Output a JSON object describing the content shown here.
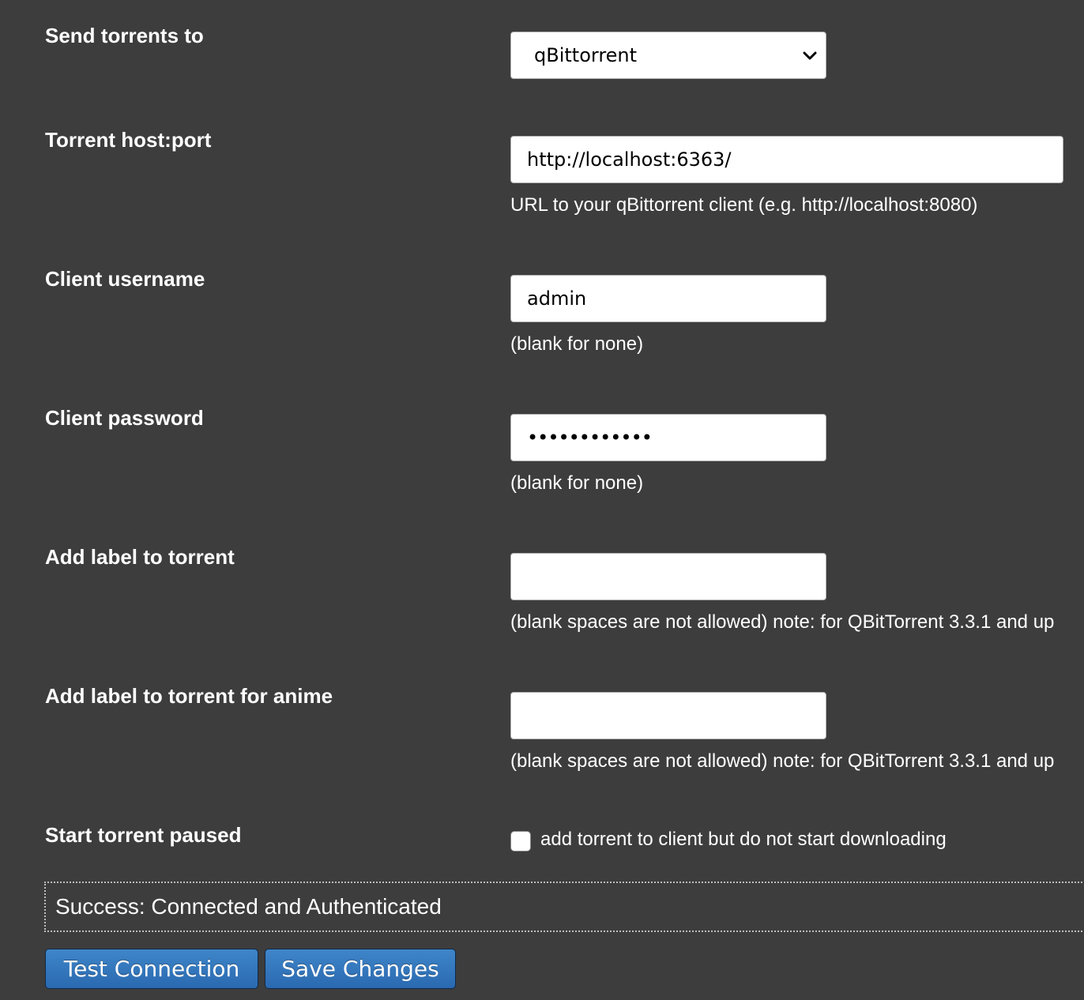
{
  "form": {
    "send_to": {
      "label": "Send torrents to",
      "selected": "qBittorrent"
    },
    "host": {
      "label": "Torrent host:port",
      "value": "http://localhost:6363/",
      "hint": "URL to your qBittorrent client (e.g. http://localhost:8080)"
    },
    "username": {
      "label": "Client username",
      "value": "admin",
      "hint": "(blank for none)"
    },
    "password": {
      "label": "Client password",
      "value": "••••••••••••",
      "hint": "(blank for none)"
    },
    "torrent_label": {
      "label": "Add label to torrent",
      "value": "",
      "hint": "(blank spaces are not allowed) note: for QBitTorrent 3.3.1 and up"
    },
    "torrent_label_anime": {
      "label": "Add label to torrent for anime",
      "value": "",
      "hint": "(blank spaces are not allowed) note: for QBitTorrent 3.3.1 and up"
    },
    "paused": {
      "label": "Start torrent paused",
      "checkbox_label": "add torrent to client but do not start downloading",
      "checked": false
    }
  },
  "status": {
    "message": "Success: Connected and Authenticated"
  },
  "buttons": {
    "test": "Test Connection",
    "save": "Save Changes"
  },
  "icons": {
    "select_arrow": "chevron-down-icon"
  },
  "colors": {
    "background": "#3d3d3d",
    "button": "#2f73b8"
  }
}
